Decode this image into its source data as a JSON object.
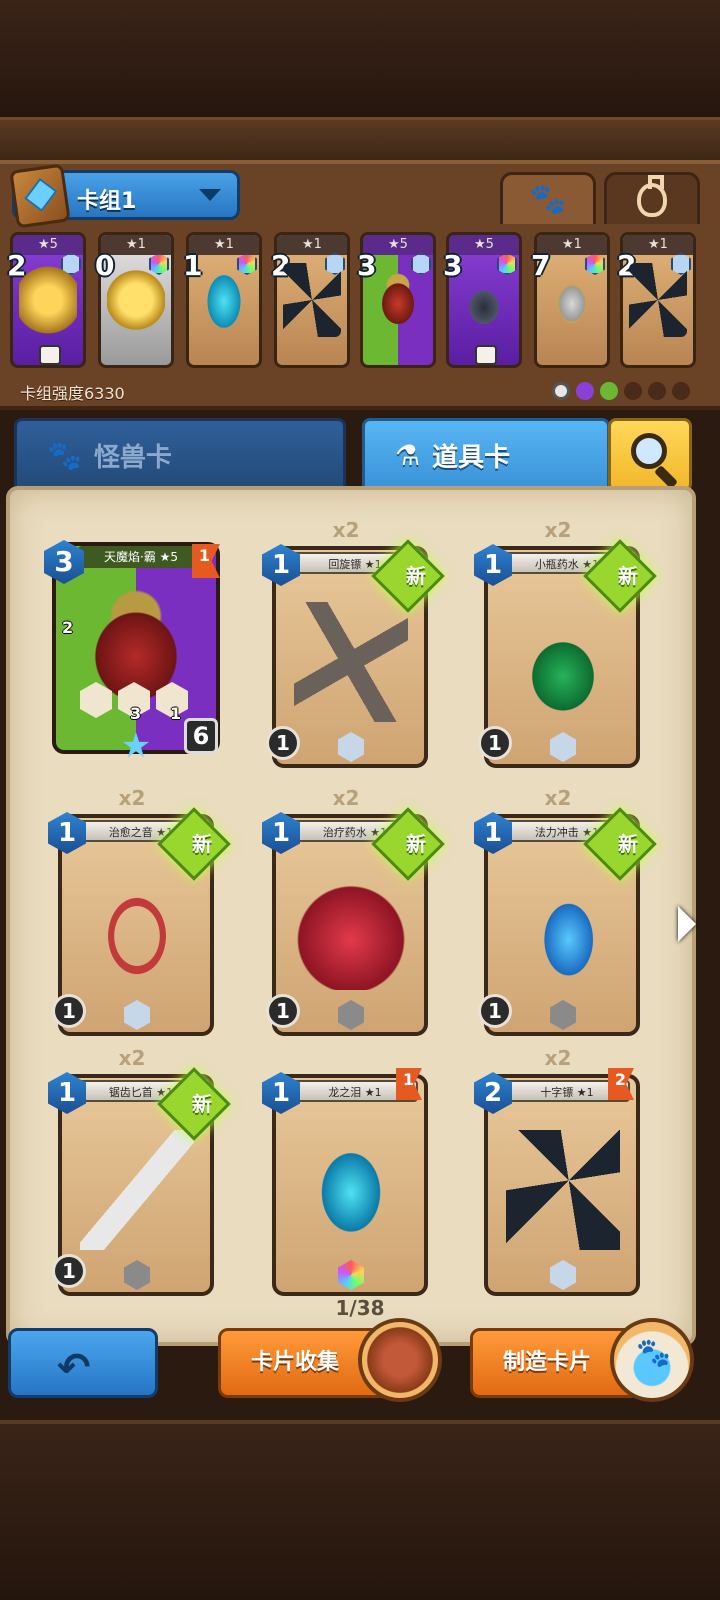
{
  "deck": {
    "name": "卡组1",
    "strength_label": "卡组强度6330",
    "cards": [
      {
        "stars": "★5",
        "cost": "2",
        "gem": "normal",
        "art": "gold-swirl",
        "frame": "purple",
        "dice": true
      },
      {
        "stars": "★1",
        "cost": "0",
        "gem": "rainbow",
        "art": "gold-coin",
        "frame": "silver",
        "dice": false
      },
      {
        "stars": "★1",
        "cost": "1",
        "gem": "rainbow",
        "art": "egg",
        "frame": "plain",
        "dice": false
      },
      {
        "stars": "★1",
        "cost": "2",
        "gem": "normal",
        "art": "shuriken",
        "frame": "plain",
        "dice": false
      },
      {
        "stars": "★5",
        "cost": "3",
        "gem": "normal",
        "art": "armor",
        "frame": "greenpurple",
        "dice": false
      },
      {
        "stars": "★5",
        "cost": "3",
        "gem": "rainbow",
        "art": "helm-dark",
        "frame": "purple",
        "dice": true
      },
      {
        "stars": "★1",
        "cost": "7",
        "gem": "rainbow",
        "art": "helm-gold",
        "frame": "plain",
        "dice": false
      },
      {
        "stars": "★1",
        "cost": "2",
        "gem": "normal",
        "art": "shuriken",
        "frame": "plain",
        "dice": false
      }
    ]
  },
  "tabs": {
    "monster": "怪兽卡",
    "item": "道具卡"
  },
  "icons": {
    "paw": "paw-icon",
    "potion": "potion-icon",
    "search": "search-icon",
    "back": "back-arrow-icon"
  },
  "monster_card": {
    "title": "天魔焰·霸 ★5",
    "cost": "3",
    "flag": "1",
    "hp": "6",
    "skill_values": [
      "2",
      "3",
      "1"
    ]
  },
  "item_cards": [
    {
      "count": "x2",
      "title": "回旋镖 ★1",
      "cost": "1",
      "new": true,
      "flag": "",
      "bottom": "1",
      "gem": "normal",
      "art": "a-boomerang"
    },
    {
      "count": "x2",
      "title": "小瓶药水 ★1",
      "cost": "1",
      "new": true,
      "flag": "",
      "bottom": "1",
      "gem": "normal",
      "art": "a-greenpot"
    },
    {
      "count": "x2",
      "title": "治愈之音 ★1",
      "cost": "1",
      "new": true,
      "flag": "",
      "bottom": "1",
      "gem": "normal",
      "art": "a-harp"
    },
    {
      "count": "x2",
      "title": "治疗药水 ★1",
      "cost": "1",
      "new": true,
      "flag": "",
      "bottom": "1",
      "gem": "dark",
      "art": "a-redpot"
    },
    {
      "count": "x2",
      "title": "法力冲击 ★1",
      "cost": "1",
      "new": true,
      "flag": "",
      "bottom": "1",
      "gem": "dark",
      "art": "a-bluepot"
    },
    {
      "count": "x2",
      "title": "锯齿匕首 ★1",
      "cost": "1",
      "new": true,
      "flag": "",
      "bottom": "1",
      "gem": "dark",
      "art": "a-dagger"
    },
    {
      "count": "",
      "title": "龙之泪 ★1",
      "cost": "1",
      "new": false,
      "flag": "1",
      "bottom": "",
      "gem": "rainbow",
      "art": "a-egg"
    },
    {
      "count": "x2",
      "title": "十字镖 ★1",
      "cost": "2",
      "new": false,
      "flag": "2",
      "bottom": "",
      "gem": "normal",
      "art": "a-shuriken"
    }
  ],
  "new_label": "新",
  "pager": "1/38",
  "buttons": {
    "collect": "卡片收集",
    "craft": "制造卡片"
  }
}
